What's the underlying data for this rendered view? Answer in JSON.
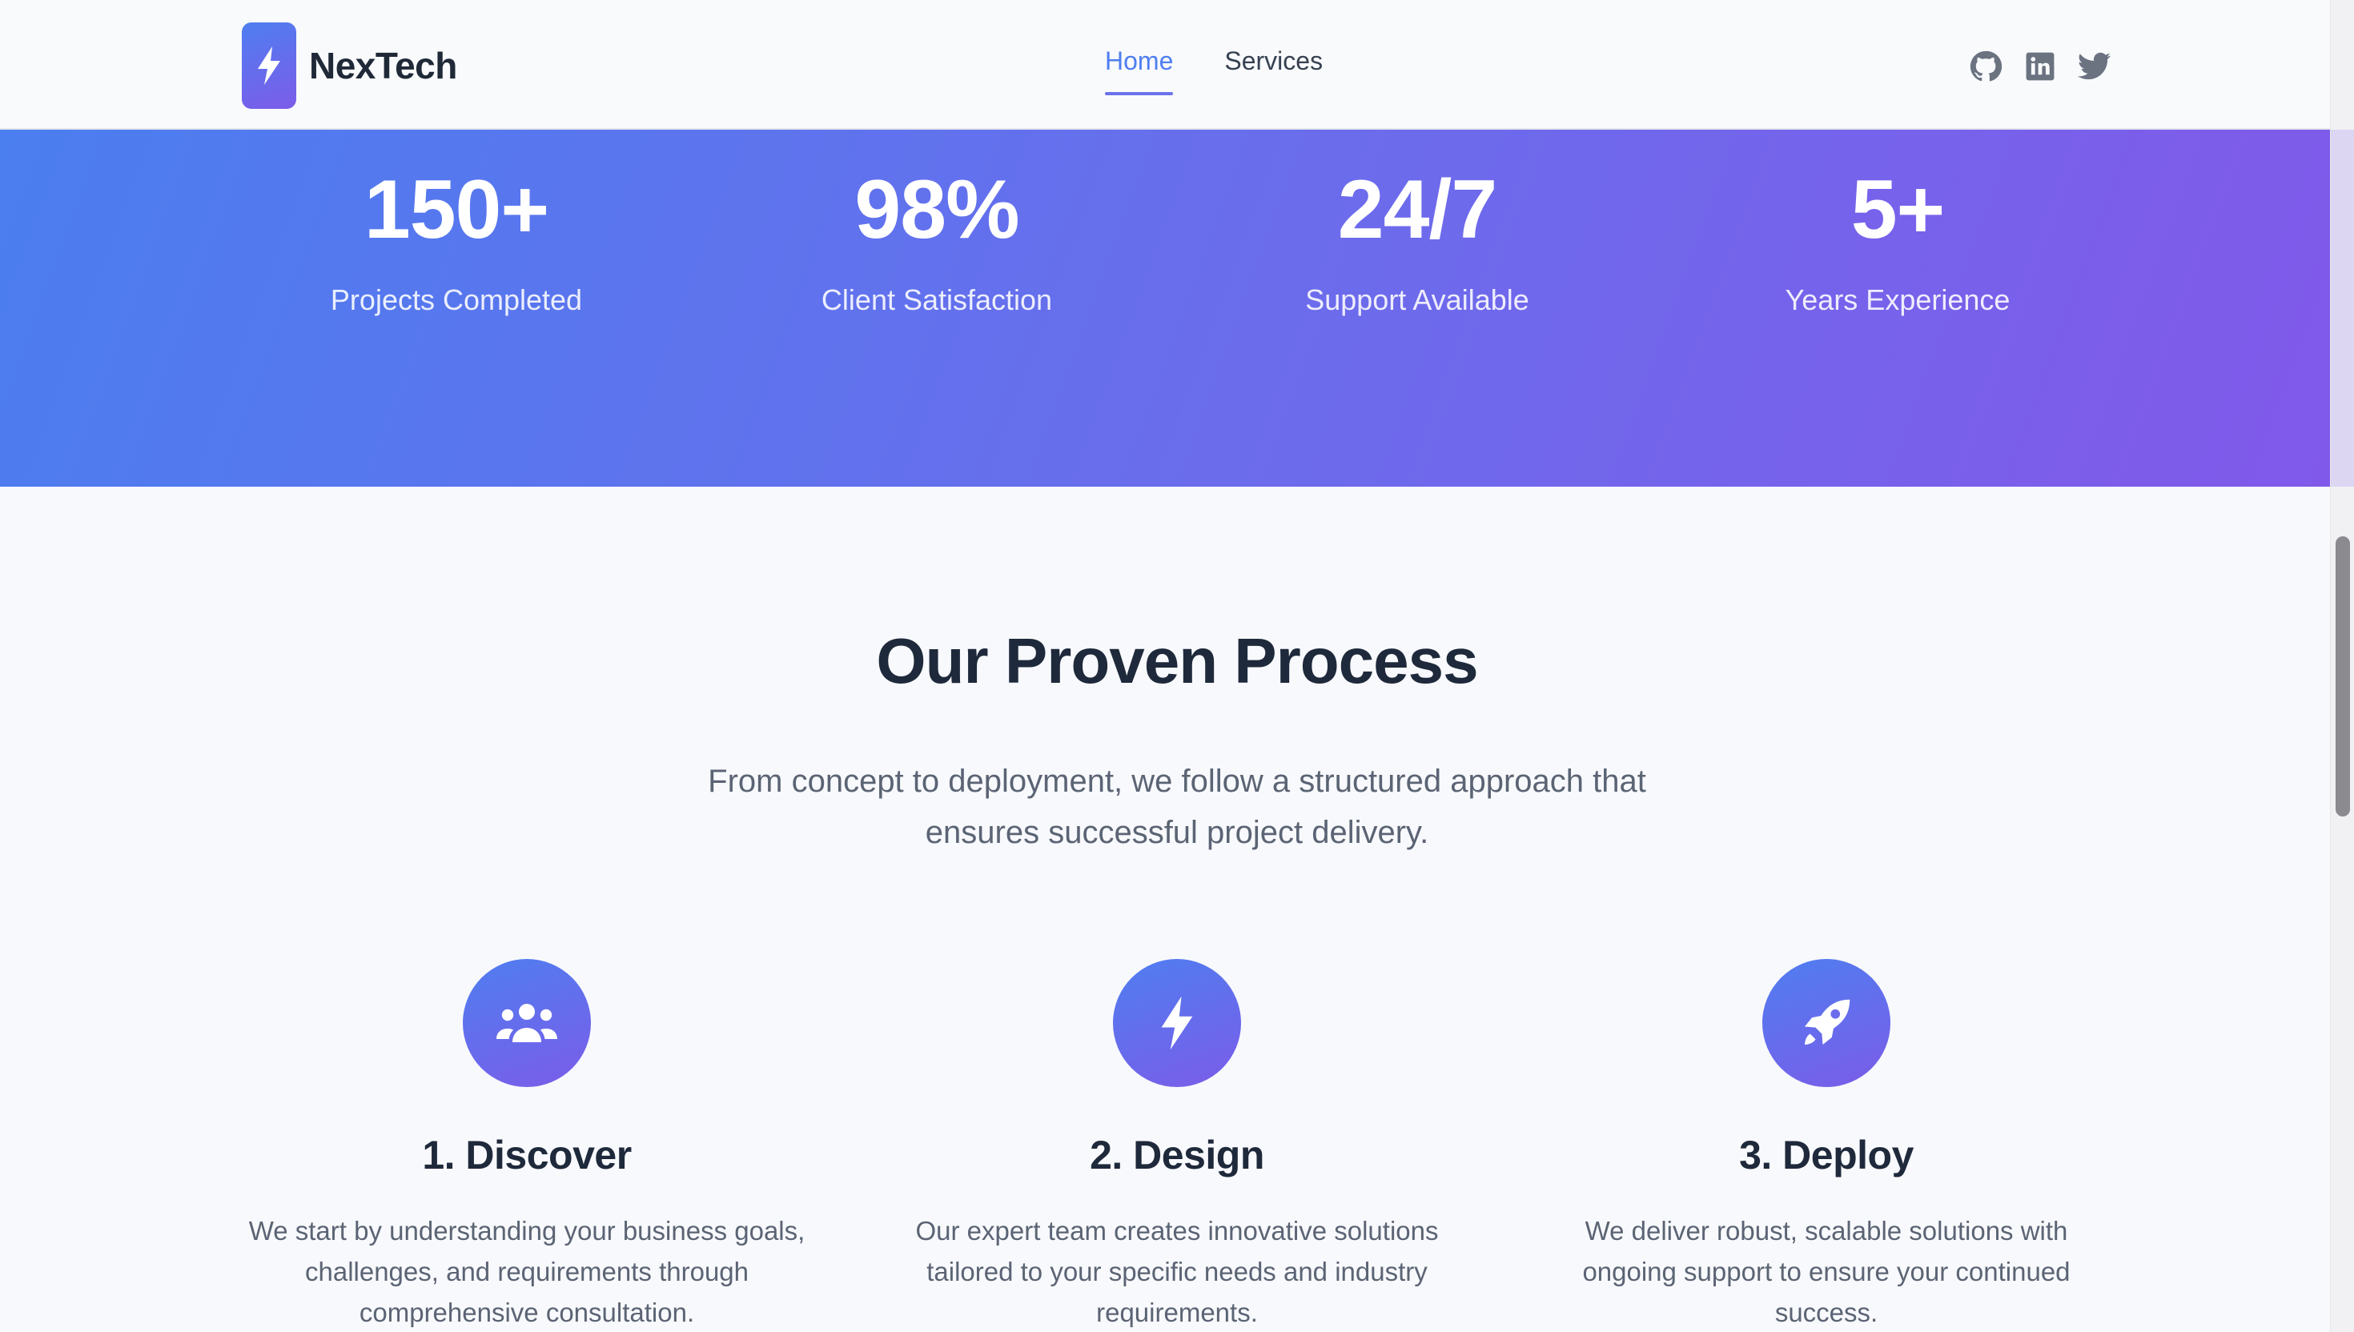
{
  "brand": {
    "name": "NexTech",
    "icon": "bolt-icon"
  },
  "nav": [
    {
      "label": "Home",
      "active": true
    },
    {
      "label": "Services",
      "active": false
    }
  ],
  "socials": [
    "github-icon",
    "linkedin-icon",
    "twitter-icon"
  ],
  "stats": [
    {
      "value": "150+",
      "label": "Projects Completed"
    },
    {
      "value": "98%",
      "label": "Client Satisfaction"
    },
    {
      "value": "24/7",
      "label": "Support Available"
    },
    {
      "value": "5+",
      "label": "Years Experience"
    }
  ],
  "process": {
    "title": "Our Proven Process",
    "subtitle": "From concept to deployment, we follow a structured approach that ensures successful project delivery.",
    "steps": [
      {
        "title": "1. Discover",
        "icon": "users-icon",
        "description": "We start by understanding your business goals, challenges, and requirements through comprehensive consultation."
      },
      {
        "title": "2. Design",
        "icon": "bolt-icon",
        "description": "Our expert team creates innovative solutions tailored to your specific needs and industry requirements."
      },
      {
        "title": "3. Deploy",
        "icon": "rocket-icon",
        "description": "We deliver robust, scalable solutions with ongoing support to ensure your continued success."
      }
    ]
  },
  "colors": {
    "accent": "#4f7ef0",
    "gradient_start": "#4b7eef",
    "gradient_end": "#8159ea",
    "text_dark": "#1e293b",
    "text_muted": "#5b6474"
  }
}
